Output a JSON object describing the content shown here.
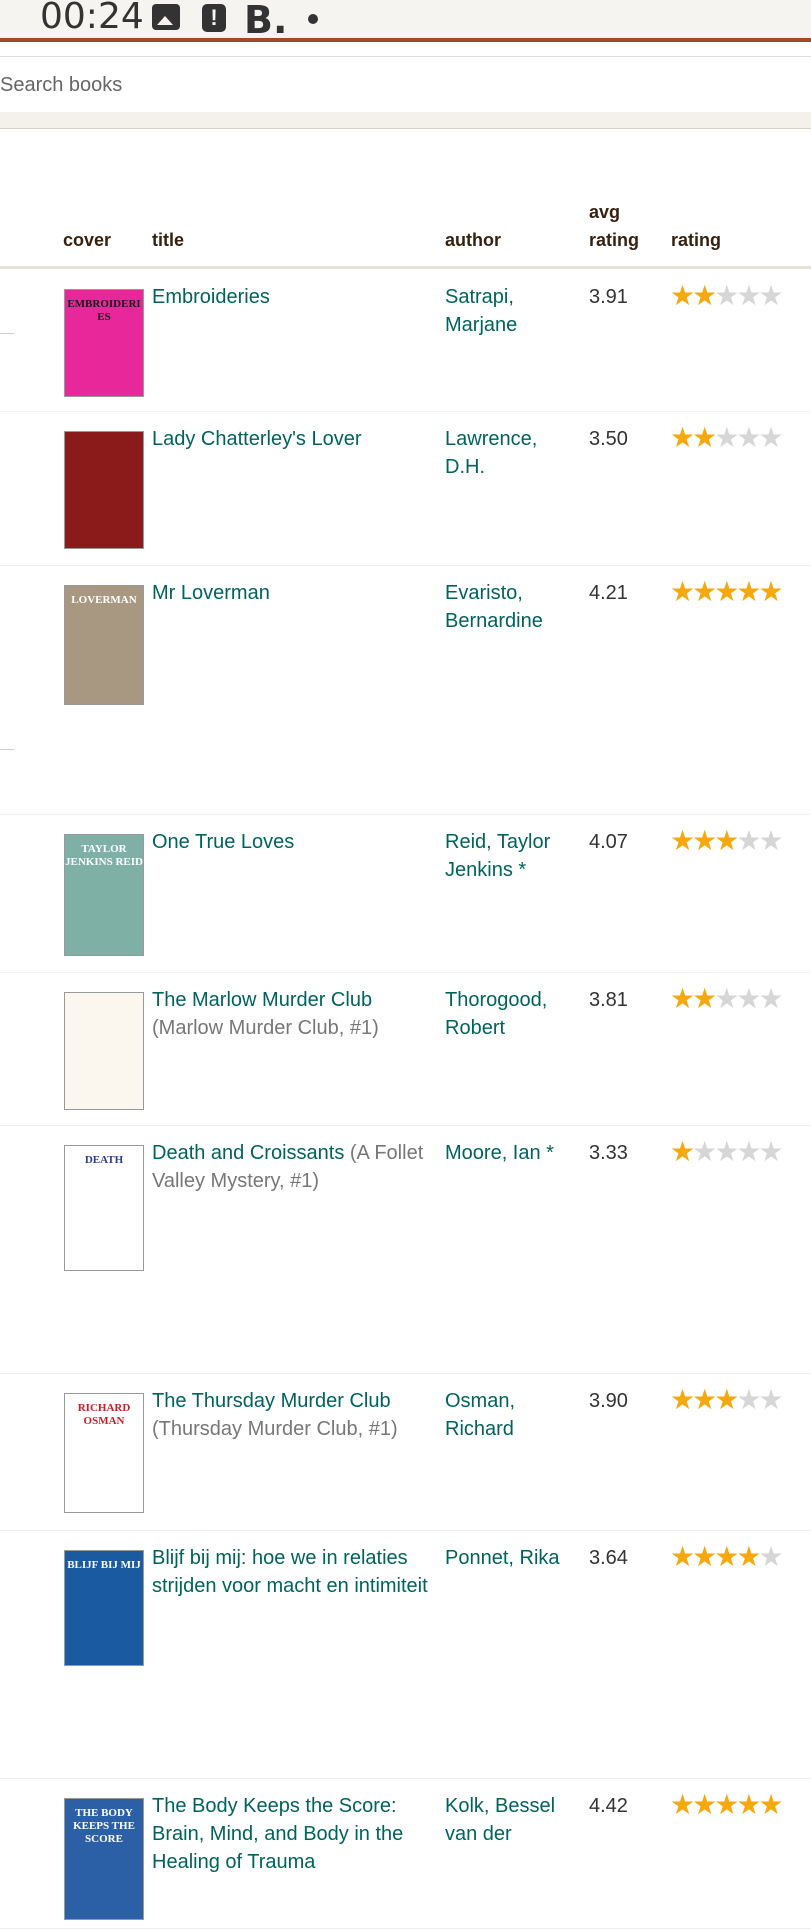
{
  "status_bar": {
    "time": "00:24",
    "app_letter": "B.",
    "alert_symbol": "!"
  },
  "search": {
    "placeholder": "Search books"
  },
  "table": {
    "headers": {
      "cover": "cover",
      "title": "title",
      "author": "author",
      "avg_rating_line1": "avg",
      "avg_rating_line2": "rating",
      "rating": "rating"
    }
  },
  "colors": {
    "link": "#00635d",
    "star_filled": "#f6a90e",
    "star_empty": "#d6d6d6",
    "accent_bar": "#a14b2b"
  },
  "books": [
    {
      "title": "Embroideries",
      "series": "",
      "author_line1": "Satrapi,",
      "author_line2": "Marjane",
      "avg_rating": "3.91",
      "rating": 2,
      "cover": {
        "bg": "#e8279a",
        "text": "EMBROIDERIES",
        "fg": "#1a1a1a"
      }
    },
    {
      "title": "Lady Chatterley's Lover",
      "series": "",
      "author_line1": "Lawrence,",
      "author_line2": "D.H.",
      "avg_rating": "3.50",
      "rating": 2,
      "cover": {
        "bg": "#8b1a1a",
        "text": "",
        "fg": "#c9b230"
      }
    },
    {
      "title": "Mr Loverman",
      "series": "",
      "author_line1": "Evaristo,",
      "author_line2": "Bernardine",
      "avg_rating": "4.21",
      "rating": 5,
      "cover": {
        "bg": "#a89882",
        "text": "LOVERMAN",
        "fg": "#ffffff"
      }
    },
    {
      "title": "One True Loves",
      "series": "",
      "author_line1": "Reid, Taylor",
      "author_line2": "Jenkins *",
      "avg_rating": "4.07",
      "rating": 3,
      "cover": {
        "bg": "#7fb0a6",
        "text": "TAYLOR JENKINS REID",
        "fg": "#ffffff"
      }
    },
    {
      "title": "The Marlow Murder Club",
      "series": "(Marlow Murder Club, #1)",
      "author_line1": "Thorogood,",
      "author_line2": "Robert",
      "avg_rating": "3.81",
      "rating": 2,
      "cover": {
        "bg": "#fbf6ee",
        "text": "",
        "fg": "#c8202a"
      }
    },
    {
      "title": "Death and Croissants",
      "series": "(A Follet Valley Mystery, #1)",
      "author_line1": "Moore, Ian *",
      "author_line2": "",
      "avg_rating": "3.33",
      "rating": 1,
      "cover": {
        "bg": "#ffffff",
        "text": "DEATH",
        "fg": "#2a3e8f"
      }
    },
    {
      "title": "The Thursday Murder Club",
      "series": "(Thursday Murder Club, #1)",
      "author_line1": "Osman,",
      "author_line2": "Richard",
      "avg_rating": "3.90",
      "rating": 3,
      "cover": {
        "bg": "#ffffff",
        "text": "RICHARD OSMAN",
        "fg": "#c8202a"
      }
    },
    {
      "title": "Blijf bij mij: hoe we in relaties strijden voor macht en intimiteit",
      "series": "",
      "author_line1": "Ponnet, Rika",
      "author_line2": "",
      "avg_rating": "3.64",
      "rating": 4,
      "cover": {
        "bg": "#1a5aa0",
        "text": "BLIJF BIJ MIJ",
        "fg": "#ffffff"
      }
    },
    {
      "title": "The Body Keeps the Score: Brain, Mind, and Body in the Healing of Trauma",
      "series": "",
      "author_line1": "Kolk, Bessel",
      "author_line2": "van der",
      "avg_rating": "4.42",
      "rating": 5,
      "cover": {
        "bg": "#2b5fa6",
        "text": "THE BODY KEEPS THE SCORE",
        "fg": "#ffffff"
      }
    }
  ]
}
